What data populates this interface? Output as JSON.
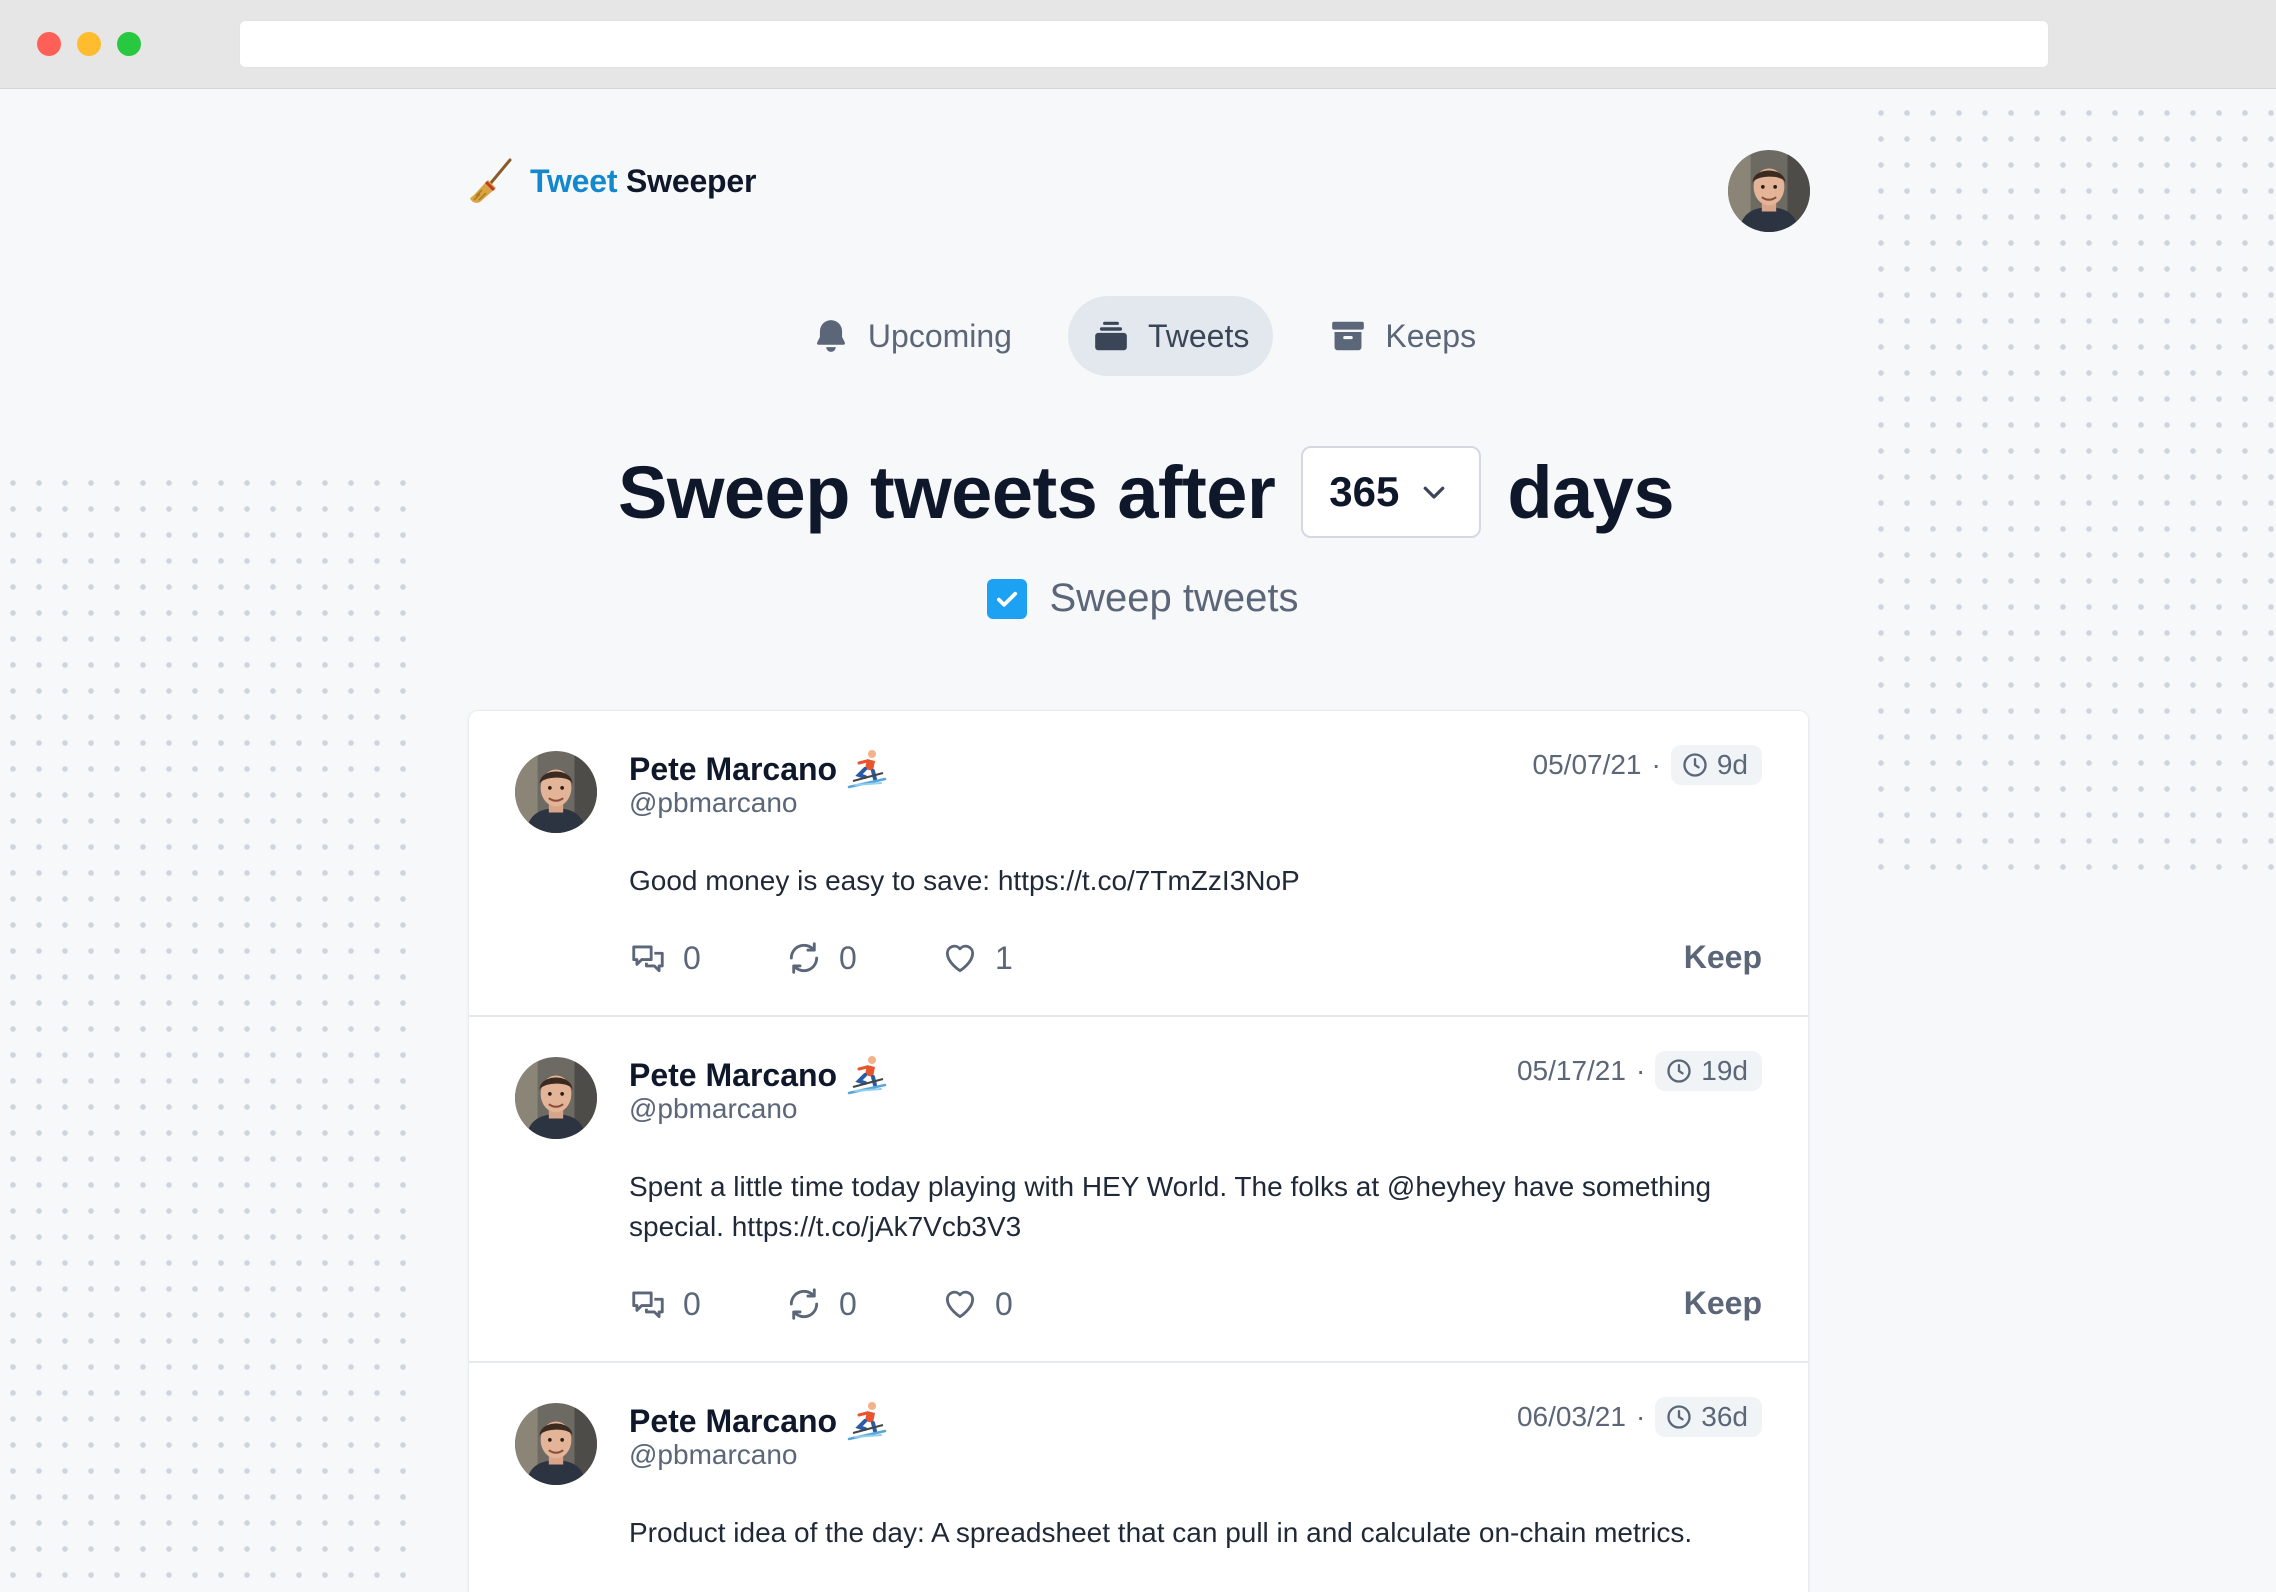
{
  "app": {
    "brand_word1": "Tweet",
    "brand_word2": "Sweeper",
    "accent_color": "#1488cc",
    "broom_icon": "broom-icon"
  },
  "nav": {
    "tabs": [
      {
        "label": "Upcoming",
        "icon": "bell-icon",
        "active": false
      },
      {
        "label": "Tweets",
        "icon": "inbox-stack-icon",
        "active": true
      },
      {
        "label": "Keeps",
        "icon": "archive-icon",
        "active": false
      }
    ]
  },
  "settings": {
    "heading_prefix": "Sweep tweets after",
    "days_value": "365",
    "heading_suffix": "days",
    "checkbox_label": "Sweep tweets",
    "checkbox_checked": true,
    "checkbox_color": "#1da1f2"
  },
  "tweets": [
    {
      "name": "Pete Marcano",
      "handle": "@pbmarcano",
      "date": "05/07/21",
      "age": "9d",
      "text": "Good money is easy to save: https://t.co/7TmZzI3NoP",
      "replies": "0",
      "retweets": "0",
      "likes": "1",
      "keep_label": "Keep"
    },
    {
      "name": "Pete Marcano",
      "handle": "@pbmarcano",
      "date": "05/17/21",
      "age": "19d",
      "text": "Spent a little time today playing with HEY World. The folks at @heyhey have something special. https://t.co/jAk7Vcb3V3",
      "replies": "0",
      "retweets": "0",
      "likes": "0",
      "keep_label": "Keep"
    },
    {
      "name": "Pete Marcano",
      "handle": "@pbmarcano",
      "date": "06/03/21",
      "age": "36d",
      "text": "Product idea of the day: A spreadsheet that can pull in and calculate on-chain metrics."
    }
  ],
  "date_separator": "·"
}
